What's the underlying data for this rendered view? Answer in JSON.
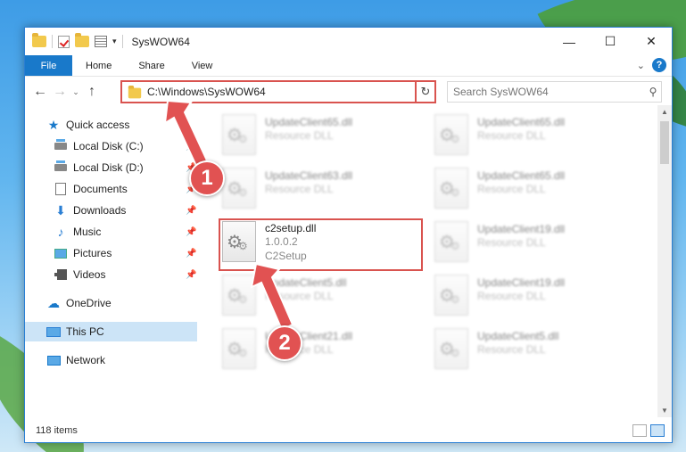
{
  "window": {
    "title": "SysWOW64",
    "controls": {
      "minimize": "—",
      "maximize": "☐",
      "close": "✕"
    }
  },
  "ribbon": {
    "file_tab": "File",
    "tabs": [
      "Home",
      "Share",
      "View"
    ]
  },
  "navigation": {
    "address": "C:\\Windows\\SysWOW64",
    "search_placeholder": "Search SysWOW64"
  },
  "sidebar": {
    "items": [
      {
        "label": "Quick access",
        "icon": "star-icon",
        "pinned": false
      },
      {
        "label": "Local Disk (C:)",
        "icon": "disk-icon",
        "pinned": true
      },
      {
        "label": "Local Disk (D:)",
        "icon": "disk-icon",
        "pinned": true
      },
      {
        "label": "Documents",
        "icon": "documents-icon",
        "pinned": true
      },
      {
        "label": "Downloads",
        "icon": "downloads-icon",
        "pinned": true
      },
      {
        "label": "Music",
        "icon": "music-icon",
        "pinned": true
      },
      {
        "label": "Pictures",
        "icon": "pictures-icon",
        "pinned": true
      },
      {
        "label": "Videos",
        "icon": "videos-icon",
        "pinned": true
      },
      {
        "label": "OneDrive",
        "icon": "onedrive-icon",
        "pinned": false
      },
      {
        "label": "This PC",
        "icon": "this-pc-icon",
        "pinned": false,
        "selected": true
      },
      {
        "label": "Network",
        "icon": "network-icon",
        "pinned": false
      }
    ]
  },
  "files": [
    {
      "name": "UpdateClient65.dll",
      "line1": "Resource DLL",
      "blurred": true
    },
    {
      "name": "UpdateClient65.dll",
      "line1": "Resource DLL",
      "blurred": true
    },
    {
      "name": "UpdateClient63.dll",
      "line1": "Resource DLL",
      "blurred": true
    },
    {
      "name": "UpdateClient65.dll",
      "line1": "Resource DLL",
      "blurred": true
    },
    {
      "name": "c2setup.dll",
      "line1": "1.0.0.2",
      "line2": "C2Setup",
      "blurred": false,
      "highlighted": true
    },
    {
      "name": "UpdateClient19.dll",
      "line1": "Resource DLL",
      "blurred": true
    },
    {
      "name": "UpdateClient5.dll",
      "line1": "Resource DLL",
      "blurred": true
    },
    {
      "name": "UpdateClient19.dll",
      "line1": "Resource DLL",
      "blurred": true
    },
    {
      "name": "UpdateClient21.dll",
      "line1": "Resource DLL",
      "blurred": true
    },
    {
      "name": "UpdateClient5.dll",
      "line1": "Resource DLL",
      "blurred": true
    }
  ],
  "status": {
    "item_count": "118 items"
  },
  "annotations": {
    "badge1": "1",
    "badge2": "2",
    "color": "#e15252"
  }
}
